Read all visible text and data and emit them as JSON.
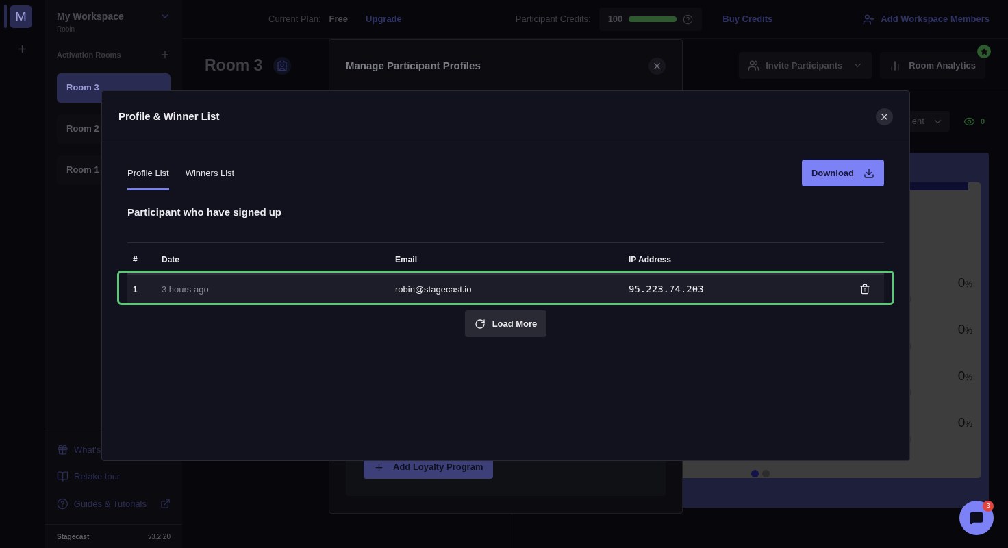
{
  "rail": {
    "avatar": "M"
  },
  "workspace": {
    "name": "My Workspace",
    "user": "Robin"
  },
  "sidebar": {
    "section": "Activation Rooms",
    "rooms": [
      {
        "label": "Room 3",
        "selected": true
      },
      {
        "label": "Room 2",
        "selected": false
      },
      {
        "label": "Room 1",
        "selected": false
      }
    ],
    "links": [
      {
        "label": "What's",
        "kind": "gift"
      },
      {
        "label": "Retake tour",
        "kind": "book"
      },
      {
        "label": "Guides & Tutorials",
        "kind": "help",
        "external": true
      }
    ],
    "footer": {
      "brand": "Stagecast",
      "version": "v3.2.20"
    }
  },
  "top_bar": {
    "plan_label": "Current Plan:",
    "plan": "Free",
    "upgrade": "Upgrade",
    "credits_label": "Participant Credits:",
    "credits": "100",
    "credits_meter": {
      "level": 1
    },
    "buy": "Buy Credits",
    "add_members": "Add Workspace Members"
  },
  "room": {
    "title": "Room 3",
    "invite": "Invite Participants",
    "analytics": "Room Analytics",
    "filter": "ent",
    "viewers": "0",
    "results": [
      {
        "value": "0",
        "unit": "%"
      },
      {
        "value": "0",
        "unit": "%"
      },
      {
        "value": "0",
        "unit": "%"
      },
      {
        "value": "0",
        "unit": "%"
      }
    ],
    "pages": [
      {
        "selected": true
      },
      {
        "selected": false
      }
    ]
  },
  "manage_dialog": {
    "title": "Manage Participant Profiles",
    "add_button": "Add Loyalty Program"
  },
  "dialog": {
    "title": "Profile & Winner List",
    "tabs": [
      {
        "label": "Profile List",
        "selected": true
      },
      {
        "label": "Winners List",
        "selected": false
      }
    ],
    "download": "Download",
    "heading": "Participant who have signed up",
    "table": {
      "columns": [
        "#",
        "Date",
        "Email",
        "IP Address"
      ],
      "rows": [
        {
          "cells": [
            "1",
            "3 hours ago",
            "robin@stagecast.io",
            "95.223.74.203"
          ],
          "highlighted": true
        }
      ]
    },
    "load_more": "Load More"
  },
  "chat": {
    "badge": "3"
  }
}
